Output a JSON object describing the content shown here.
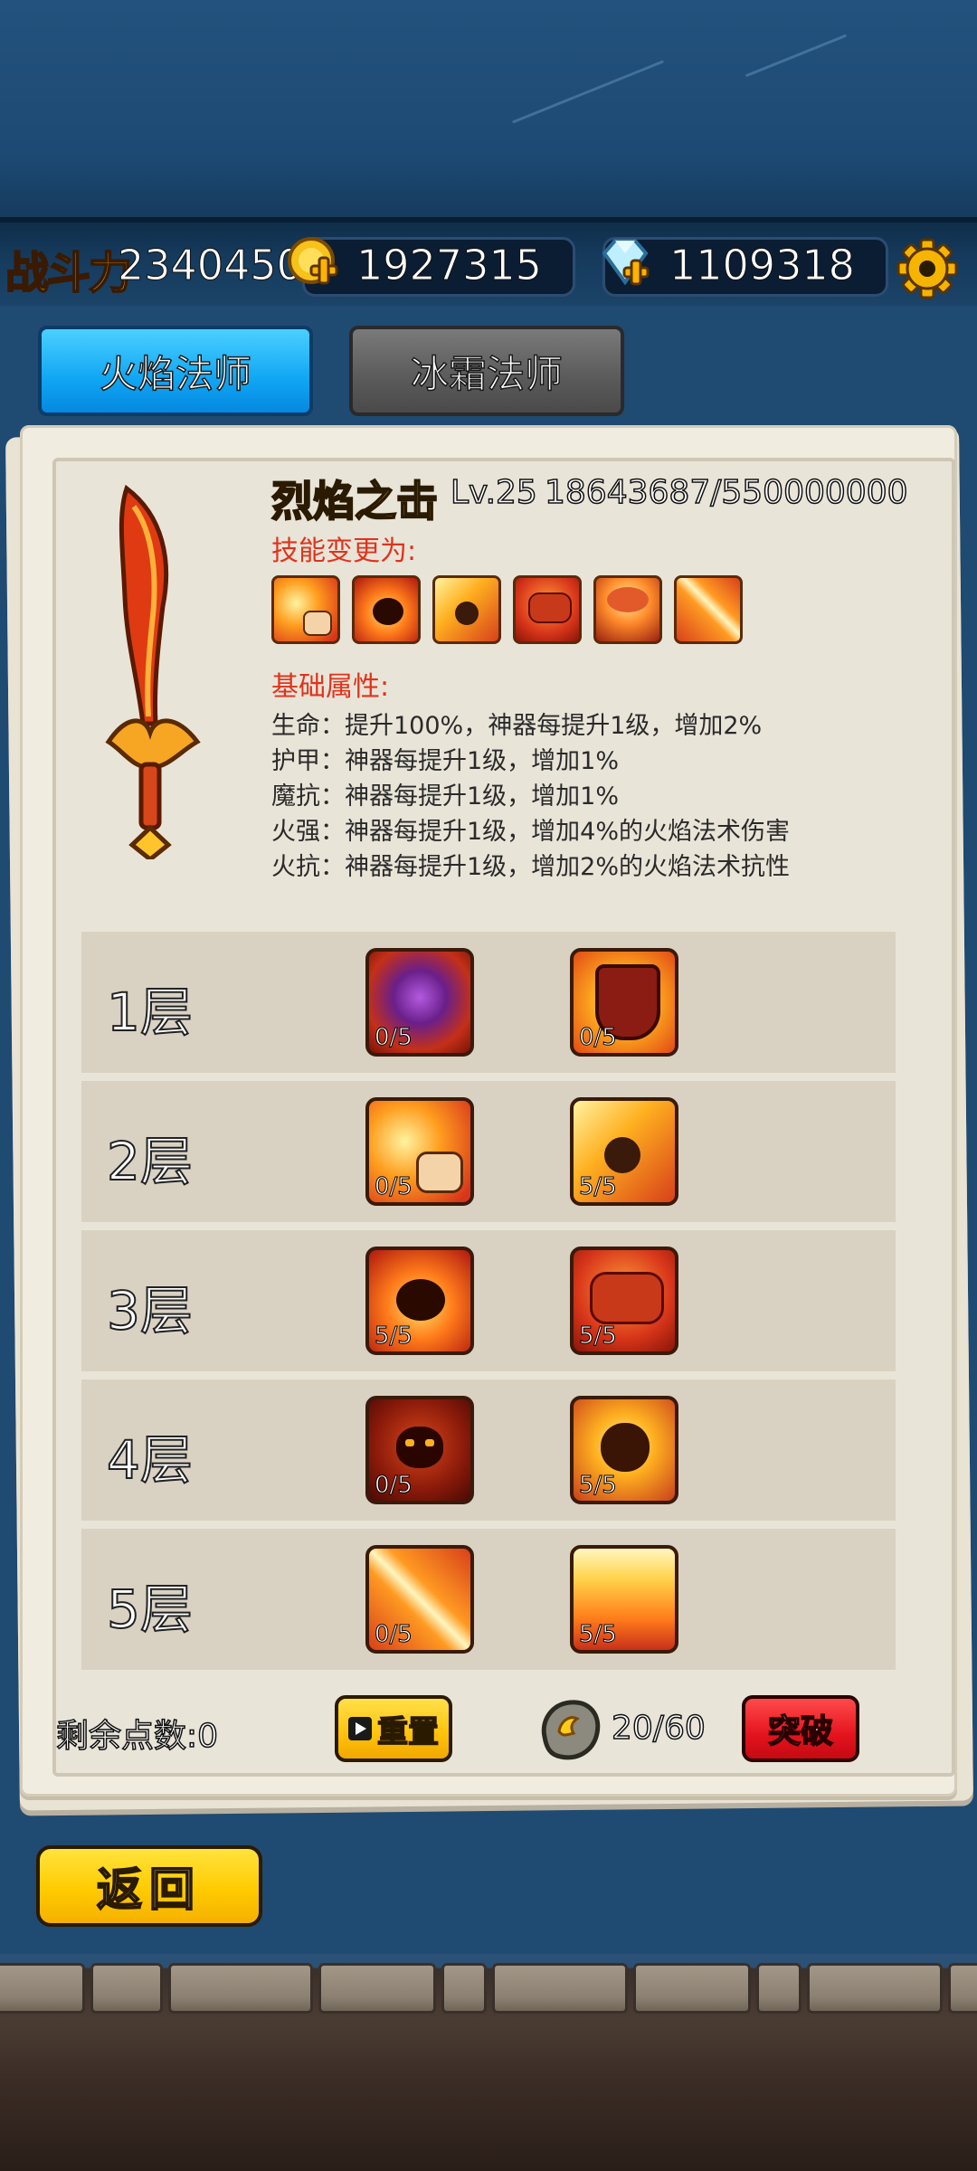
{
  "header": {
    "power_label": "战斗力",
    "power_value": "2340450",
    "gold_value": "1927315",
    "gem_value": "1109318",
    "icons": [
      "gold-coin-plus-icon",
      "diamond-plus-icon",
      "gear-icon"
    ]
  },
  "tabs": [
    {
      "label": "火焰法师",
      "active": true
    },
    {
      "label": "冰霜法师",
      "active": false
    }
  ],
  "artifact": {
    "skill_name": "烈焰之击",
    "level": "Lv.25",
    "exp": "18643687/550000000",
    "skill_change_heading": "技能变更为:",
    "base_attr_heading": "基础属性:",
    "attributes": [
      "生命：提升100%，神器每提升1级，增加2%",
      "护甲：神器每提升1级，增加1%",
      "魔抗：神器每提升1级，增加1%",
      "火强：神器每提升1级，增加4%的火焰法术伤害",
      "火抗：神器每提升1级，增加2%的火焰法术抗性"
    ]
  },
  "tiers": [
    {
      "label": "1层",
      "skills": [
        {
          "count": "0/5",
          "icon": "purple-gem-ring-icon"
        },
        {
          "count": "0/5",
          "icon": "fire-shield-icon"
        }
      ]
    },
    {
      "label": "2层",
      "skills": [
        {
          "count": "0/5",
          "icon": "fire-hand-icon"
        },
        {
          "count": "5/5",
          "icon": "meteor-icon"
        }
      ]
    },
    {
      "label": "3层",
      "skills": [
        {
          "count": "5/5",
          "icon": "fire-spirit-icon"
        },
        {
          "count": "5/5",
          "icon": "fire-golem-icon"
        }
      ]
    },
    {
      "label": "4层",
      "skills": [
        {
          "count": "0/5",
          "icon": "fire-demon-icon"
        },
        {
          "count": "5/5",
          "icon": "flaming-skull-icon"
        }
      ]
    },
    {
      "label": "5层",
      "skills": [
        {
          "count": "0/5",
          "icon": "fire-slash-icon"
        },
        {
          "count": "5/5",
          "icon": "fire-pillar-icon"
        }
      ]
    }
  ],
  "footer": {
    "remaining_points": "剩余点数:0",
    "reset_label": "重置",
    "stone_count": "20/60",
    "breakthrough_label": "突破",
    "back_label": "返回"
  }
}
